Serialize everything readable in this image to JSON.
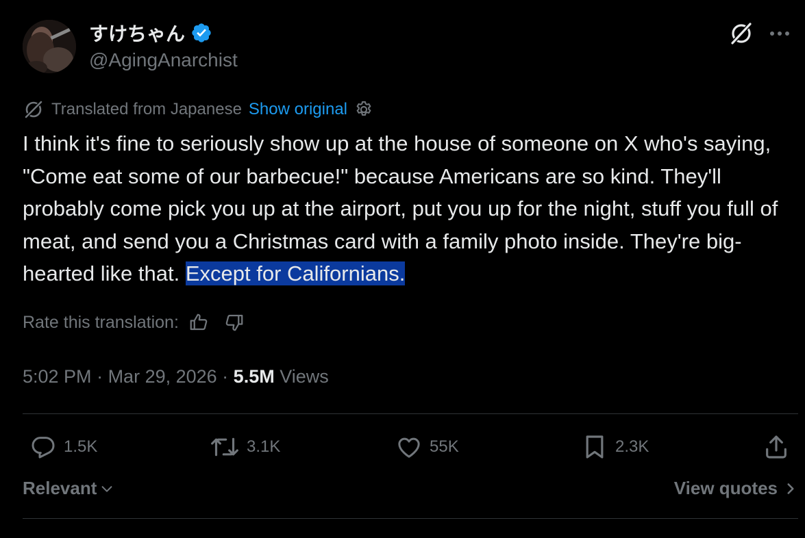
{
  "author": {
    "display_name": "すけちゃん",
    "handle": "@AgingAnarchist",
    "verified_icon": "verified-badge-icon"
  },
  "header_actions": {
    "grok_icon": "grok-icon",
    "more_icon": "more-icon"
  },
  "translation": {
    "label": "Translated from Japanese",
    "show_original": "Show original",
    "icon": "translate-icon",
    "settings_icon": "gear-icon"
  },
  "post": {
    "text_main": "I think it's fine to seriously show up at the house of someone on X who's saying, \"Come eat some of our barbecue!\" because Americans are so kind. They'll probably come pick you up at the airport, put you up for the night, stuff you full of meat, and send you a Christmas card with a family photo inside. They're big-hearted like that. ",
    "text_highlighted": "Except for Californians."
  },
  "rate": {
    "label": "Rate this translation:",
    "up_icon": "thumbs-up-icon",
    "down_icon": "thumbs-down-icon"
  },
  "meta": {
    "time": "5:02 PM",
    "sep1": " · ",
    "date": "Mar 29, 2026",
    "sep2": " · ",
    "views_count": "5.5M",
    "views_label": " Views"
  },
  "actions": {
    "replies": "1.5K",
    "reposts": "3.1K",
    "likes": "55K",
    "bookmarks": "2.3K"
  },
  "footer": {
    "sort_label": "Relevant",
    "view_quotes": "View quotes"
  },
  "colors": {
    "background": "#000000",
    "text": "#e7e9ea",
    "muted": "#71767b",
    "accent": "#1d9bf0",
    "highlight": "#0b3a9e",
    "divider": "#2f3336"
  }
}
